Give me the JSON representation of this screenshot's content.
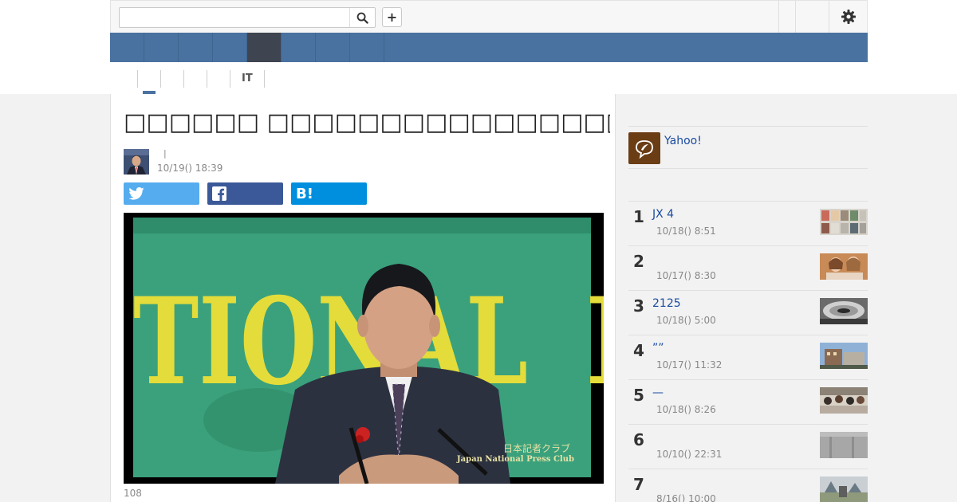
{
  "search": {
    "placeholder": ""
  },
  "toolbar": {
    "plus_label": "+"
  },
  "subnav": {
    "items": [
      "",
      "",
      "",
      "",
      "IT",
      ""
    ]
  },
  "article": {
    "title": "□□□□□□ □□□□□□□□□□□□□□□□□□□□□□ (□)",
    "author_sep": "|",
    "date": "10/19() 18:39",
    "views": "108",
    "hatena_label": "B!"
  },
  "video": {
    "banner_text": "TIONAL",
    "banner_text_right": "I",
    "watermark_jp": "日本記者クラブ",
    "watermark_en": "Japan National Press Club"
  },
  "sidebar": {
    "yahoo_text": "Yahoo!",
    "ranking": [
      {
        "rank": "1",
        "title": "JX 4",
        "date": "10/18() 8:51"
      },
      {
        "rank": "2",
        "title": "",
        "date": "10/17() 8:30"
      },
      {
        "rank": "3",
        "title": "2125",
        "date": "10/18() 5:00"
      },
      {
        "rank": "4",
        "title": "””",
        "date": "10/17() 11:32"
      },
      {
        "rank": "5",
        "title": "—",
        "date": "10/18() 8:26"
      },
      {
        "rank": "6",
        "title": "",
        "date": "10/10() 22:31"
      },
      {
        "rank": "7",
        "title": "",
        "date": "8/16() 10:00"
      }
    ]
  },
  "colors": {
    "nav_blue": "#4a72a0",
    "nav_active": "#3f4550",
    "twitter": "#55acee",
    "facebook": "#3b5998",
    "hatena": "#008fde",
    "link": "#1a4ba0",
    "video_green": "#3aa17c",
    "banner_yellow": "#e4dc3a"
  },
  "icons": {
    "search": "search-icon",
    "gear": "gear-icon",
    "twitter": "twitter-icon",
    "facebook": "facebook-icon",
    "yahoo": "yahoo-creators-icon"
  }
}
